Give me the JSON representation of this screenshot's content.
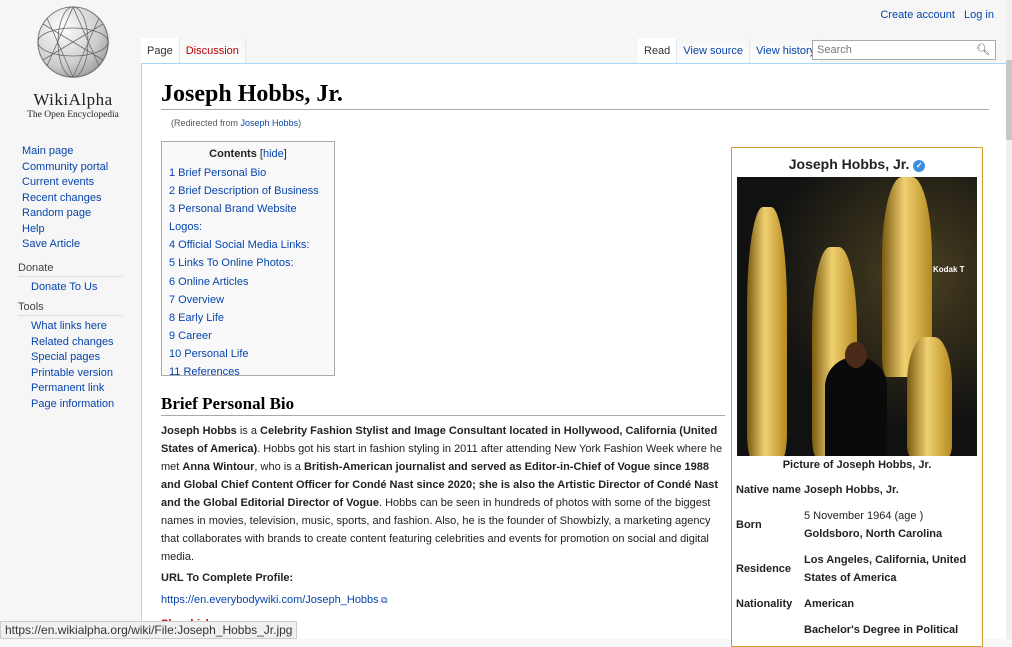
{
  "logo": {
    "wordmark": "WikiAlpha",
    "tagline": "The Open Encyclopedia"
  },
  "personal": {
    "create_account": "Create account",
    "log_in": "Log in"
  },
  "tabs": {
    "page": "Page",
    "discussion": "Discussion",
    "read": "Read",
    "view_source": "View source",
    "view_history": "View history"
  },
  "search": {
    "placeholder": "Search"
  },
  "sidebar": {
    "nav": [
      "Main page",
      "Community portal",
      "Current events",
      "Recent changes",
      "Random page",
      "Help",
      "Save Article"
    ],
    "donate_heading": "Donate",
    "donate": [
      "Donate To Us"
    ],
    "tools_heading": "Tools",
    "tools": [
      "What links here",
      "Related changes",
      "Special pages",
      "Printable version",
      "Permanent link",
      "Page information"
    ]
  },
  "article": {
    "title": "Joseph Hobbs, Jr.",
    "redirect_prefix": "(Redirected from ",
    "redirect_link": "Joseph Hobbs",
    "redirect_suffix": ")",
    "toc": {
      "title": "Contents",
      "hide": "hide",
      "items": [
        "1 Brief Personal Bio",
        "2 Brief Description of Business",
        "3 Personal Brand Website Logos:",
        "4 Official Social Media Links:",
        "5 Links To Online Photos:",
        "6 Online Articles",
        "7 Overview",
        "8 Early Life",
        "9 Career",
        "10 Personal Life",
        "11 References"
      ]
    },
    "section1": "Brief Personal Bio",
    "bio": {
      "b1": "Joseph Hobbs",
      "t1": " is a ",
      "b2": "Celebrity Fashion Stylist and Image Consultant located in Hollywood, California (United States of America)",
      "t2": ". Hobbs got his start in fashion styling in 2011 after attending New York Fashion Week where he met ",
      "b3": "Anna Wintour",
      "t3": ", who is a ",
      "b4": "British-American journalist and served as Editor-in-Chief of Vogue since 1988 and Global Chief Content Officer for Condé Nast since 2020; she is also the Artistic Director of Condé Nast and the Global Editorial Director of Vogue",
      "t4": ". Hobbs can be seen in hundreds of photos with some of the biggest names in movies, television, music, sports, and fashion. Also, he is the founder of Showbizly, a marketing agency that collaborates with brands to create content featuring celebrities and events for promotion on social and digital media."
    },
    "url_label": "URL To Complete Profile:",
    "url": "https://en.everybodywiki.com/Joseph_Hobbs",
    "next_link": "Showbizly"
  },
  "infobox": {
    "title": "Joseph Hobbs, Jr.",
    "caption": "Picture of Joseph Hobbs, Jr.",
    "photo_sign": "Kodak T",
    "rows": [
      {
        "k": "Native name",
        "v": "Joseph Hobbs, Jr."
      },
      {
        "k": "Born",
        "v1": "5 November 1964 (age )",
        "v": "Goldsboro, North Carolina"
      },
      {
        "k": "Residence",
        "v": "Los Angeles, California, United States of America"
      },
      {
        "k": "Nationality",
        "v": "American"
      },
      {
        "k": "",
        "v": "Bachelor's Degree in Political"
      }
    ]
  },
  "status_bar": "https://en.wikialpha.org/wiki/File:Joseph_Hobbs_Jr.jpg",
  "colors": {
    "link": "#0645ad",
    "redlink": "#ba0000",
    "infobox_border": "#d29a2c"
  }
}
